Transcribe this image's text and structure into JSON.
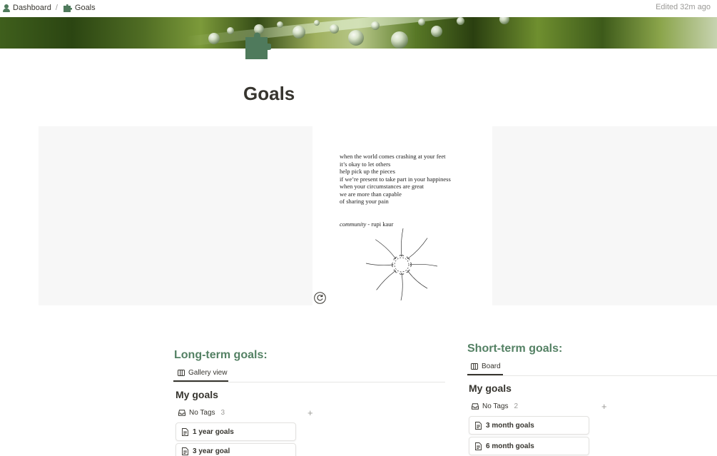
{
  "breadcrumb": {
    "items": [
      {
        "label": "Dashboard",
        "icon": "user-icon"
      },
      {
        "label": "Goals",
        "icon": "puzzle-icon"
      }
    ],
    "separator": "/"
  },
  "edited": "Edited 32m ago",
  "page": {
    "title": "Goals",
    "icon": "puzzle-icon",
    "accent_color": "#548164"
  },
  "embed": {
    "poem_lines": [
      "when the world comes crashing at your feet",
      "it’s okay to let others",
      "help pick up the pieces",
      "if we’re present to take part in your happiness",
      "when your circumstances are great",
      "we are more than capable",
      "of sharing your pain"
    ],
    "credit_title": "community",
    "credit_author": " - rupi kaur",
    "refresh_icon": "refresh-icon"
  },
  "long_term": {
    "heading": "Long-term goals:",
    "view_tab": "Gallery view",
    "db_title": "My goals",
    "group_label": "No Tags",
    "group_count": "3",
    "cards": [
      "1 year goals",
      "3 year goal"
    ]
  },
  "short_term": {
    "heading": "Short-term goals:",
    "view_tab": "Board",
    "db_title": "My goals",
    "group_label": "No Tags",
    "group_count": "2",
    "cards": [
      "3 month goals",
      "6 month goals"
    ]
  }
}
